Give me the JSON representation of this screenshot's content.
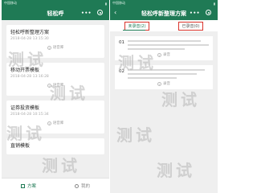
{
  "left": {
    "status": {
      "carrier": "中国移动",
      "time": "",
      "battery": ""
    },
    "title": "轻松呼",
    "cards": [
      {
        "title": "轻松呼新整理方案",
        "date": "2018-04-28 13:15:30",
        "play": "语音库"
      },
      {
        "title": "移动开票模板",
        "date": "2018-04-28 13:16:28",
        "play": "语音库"
      },
      {
        "title": "证券投资模板",
        "date": "2018-04-28 10:15:34",
        "play": "语音库"
      },
      {
        "title": "直销模板",
        "date": "",
        "play": ""
      }
    ],
    "nav": [
      {
        "label": "方案",
        "active": true
      },
      {
        "label": "我的",
        "active": false
      }
    ],
    "watermark": [
      "测试",
      "测试",
      "测试",
      "测试"
    ]
  },
  "right": {
    "status": {
      "carrier": "中国移动",
      "time": "",
      "battery": ""
    },
    "back": "‹",
    "title": "轻松呼新整理方案",
    "tabs": [
      {
        "label": "未录音(2)",
        "active": true
      },
      {
        "label": "已录音(0)",
        "active": false
      }
    ],
    "items": [
      {
        "num": "01",
        "play": "录音"
      },
      {
        "num": "02",
        "play": "录音"
      }
    ],
    "watermark": [
      "测试",
      "测试",
      "测试",
      "测试"
    ]
  },
  "colors": {
    "brand": "#1f7a55",
    "highlight": "#d9332b",
    "background": "#efefef"
  }
}
